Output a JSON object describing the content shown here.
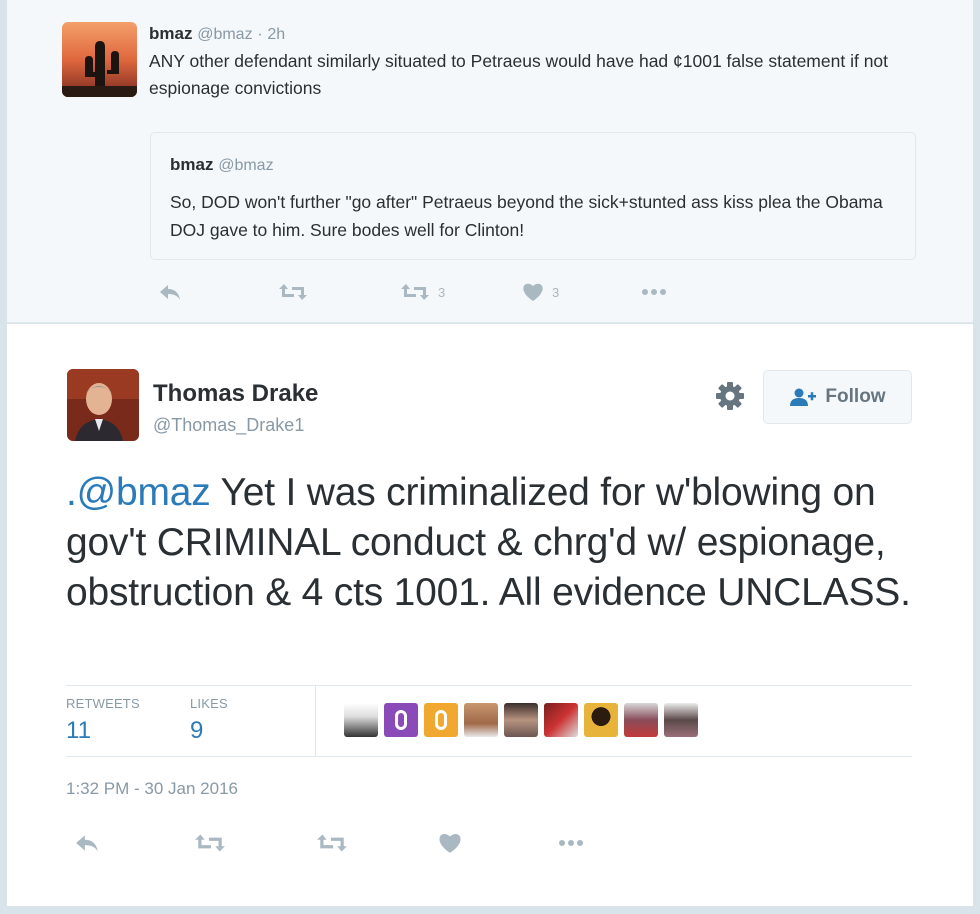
{
  "parent_tweet": {
    "name": "bmaz",
    "handle": "@bmaz",
    "dot": "·",
    "time": "2h",
    "text": "ANY other defendant similarly situated to Petraeus would have had ¢1001 false statement if not espionage convictions",
    "quoted": {
      "name": "bmaz",
      "handle": "@bmaz",
      "text": "So, DOD won't further \"go after\" Petraeus beyond the sick+stunted ass kiss plea the Obama DOJ gave to him. Sure bodes well for Clinton!"
    },
    "actions": {
      "reply_icon": "reply-icon",
      "retweet_icon": "retweet-icon",
      "retweet_count": "3",
      "like_icon": "heart-icon",
      "like_count": "3",
      "more_icon": "more-icon"
    }
  },
  "main_tweet": {
    "name": "Thomas Drake",
    "handle": "@Thomas_Drake1",
    "follow_label": "Follow",
    "text_mention": ".@bmaz",
    "text_body": " Yet I was criminalized for w'blowing on gov't CRIMINAL conduct & chrg'd w/ espionage, obstruction & 4 cts 1001. All evidence UNCLASS.",
    "stats": {
      "retweets_label": "RETWEETS",
      "retweets": "11",
      "likes_label": "LIKES",
      "likes": "9"
    },
    "timestamp": "1:32 PM - 30 Jan 2016"
  },
  "colors": {
    "link": "#2b7bb9",
    "muted": "#8899a6",
    "icon": "#aab8c2",
    "text": "#292f33"
  }
}
